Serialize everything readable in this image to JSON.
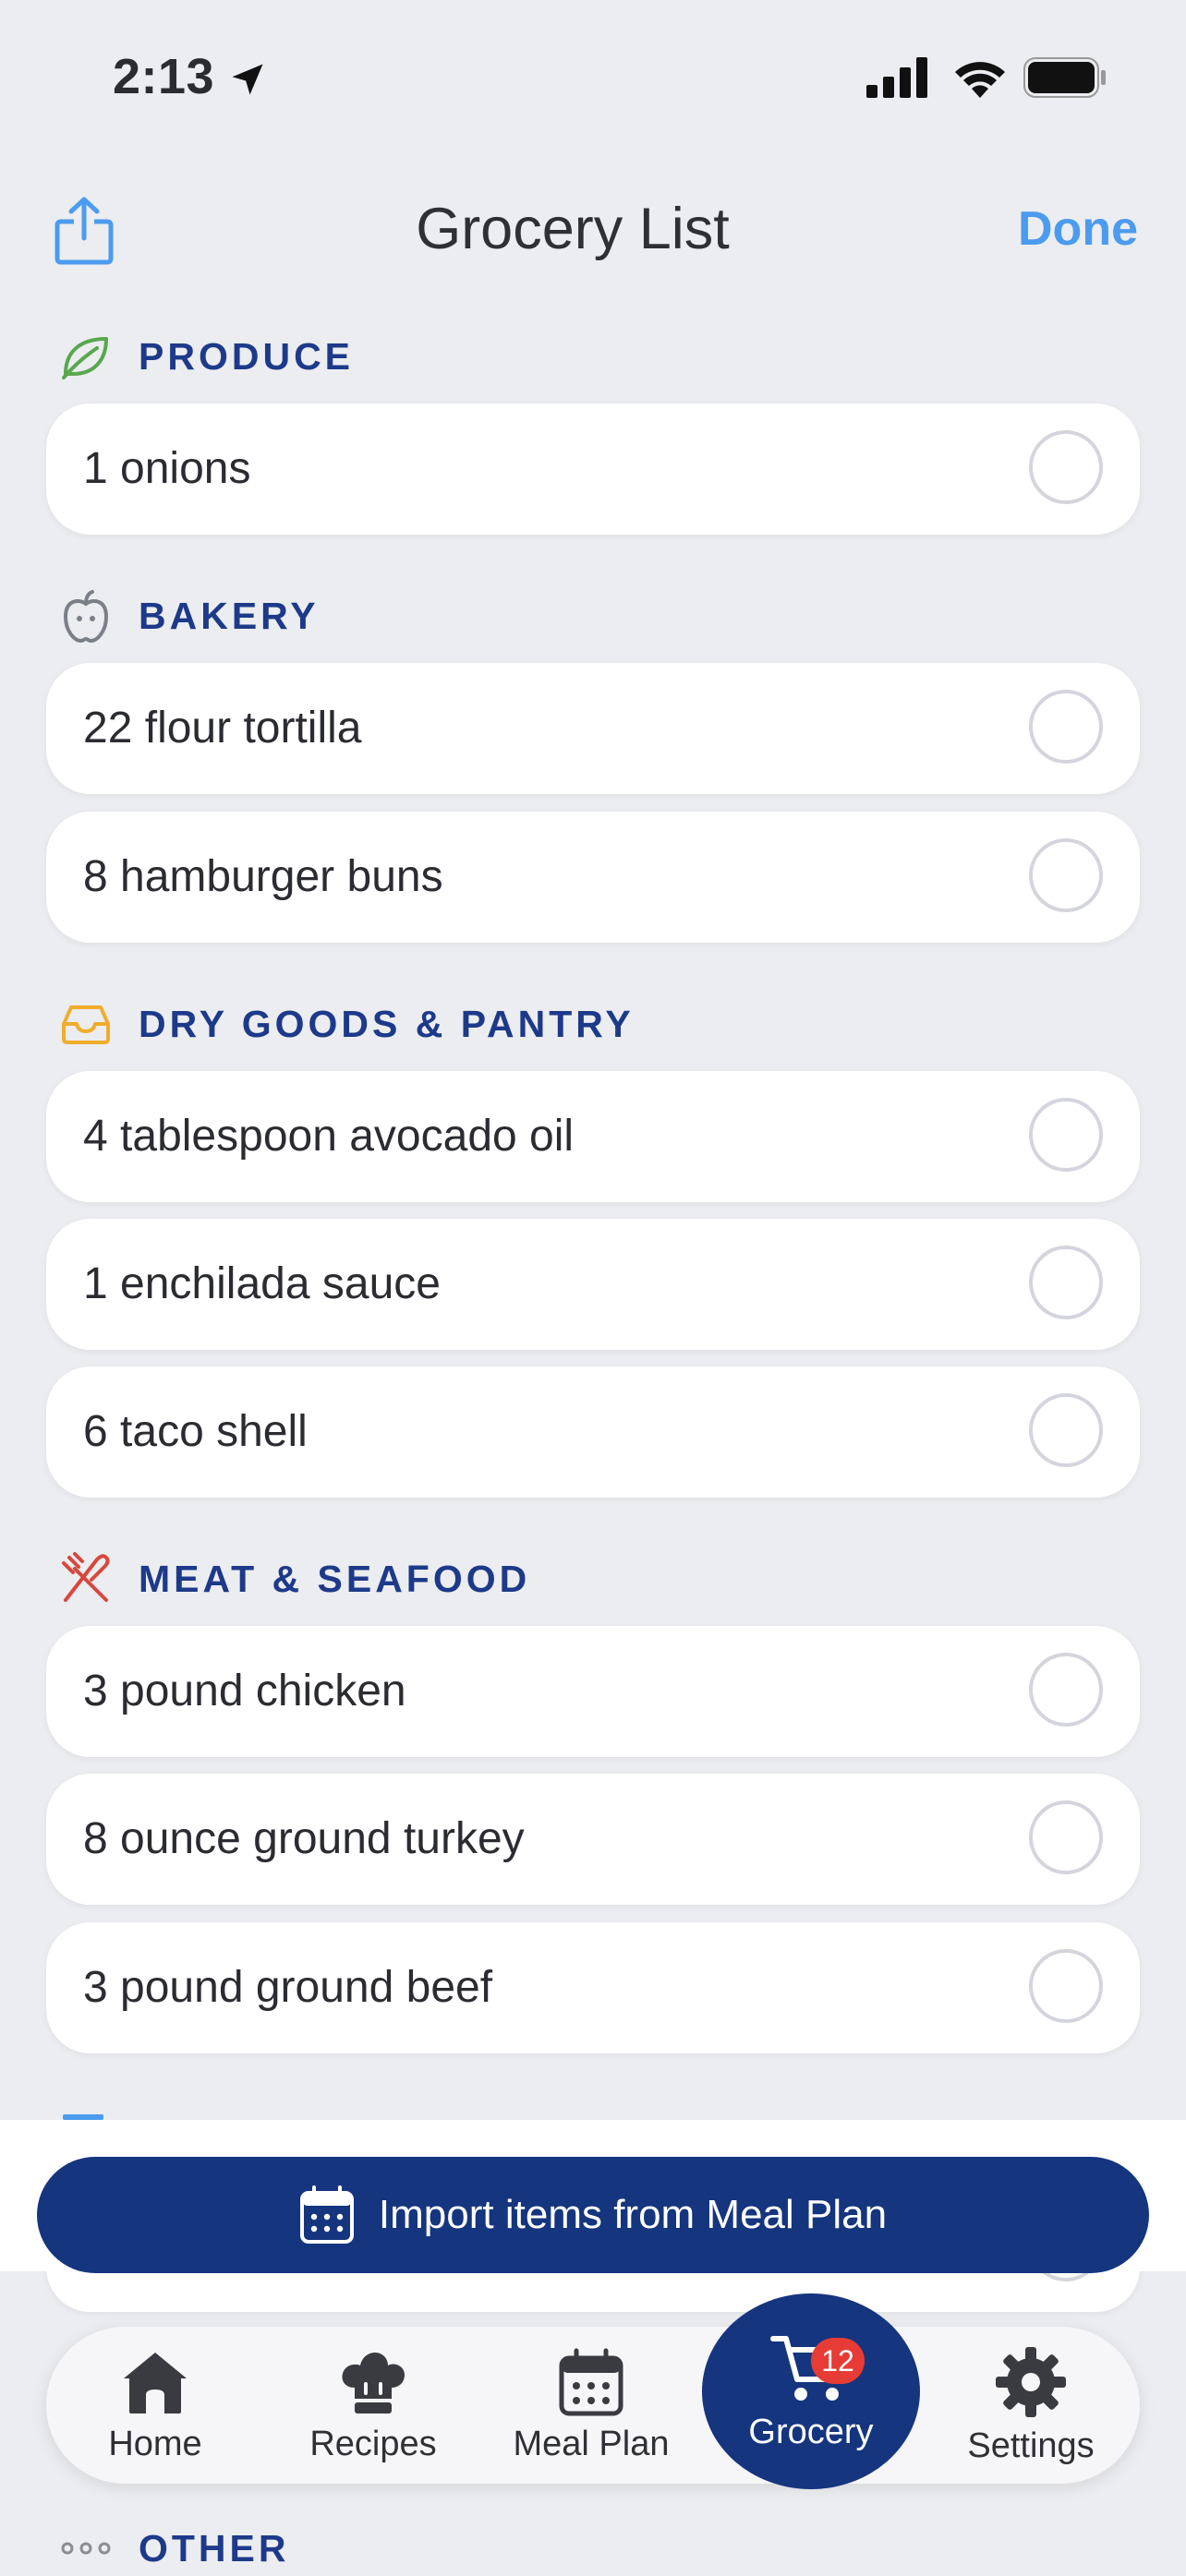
{
  "status_bar": {
    "time": "2:13"
  },
  "nav": {
    "title": "Grocery List",
    "done_label": "Done"
  },
  "sections": [
    {
      "label": "PRODUCE",
      "icon": "leaf-icon",
      "items": [
        "1 onions"
      ]
    },
    {
      "label": "BAKERY",
      "icon": "apple-icon",
      "items": [
        "22 flour tortilla",
        "8 hamburger buns"
      ]
    },
    {
      "label": "DRY GOODS & PANTRY",
      "icon": "tray-icon",
      "items": [
        "4 tablespoon avocado oil",
        "1 enchilada sauce",
        "6 taco shell"
      ]
    },
    {
      "label": "MEAT & SEAFOOD",
      "icon": "fork-knife-icon",
      "items": [
        "3 pound chicken",
        "8 ounce ground turkey",
        "3 pound ground beef"
      ]
    },
    {
      "label": "OTHER",
      "icon": "ellipsis-icon",
      "items": []
    }
  ],
  "import_button": {
    "label": "Import items from Meal Plan",
    "icon": "calendar-icon"
  },
  "tabs": [
    {
      "label": "Home",
      "icon": "house-icon"
    },
    {
      "label": "Recipes",
      "icon": "chef-hat-icon"
    },
    {
      "label": "Meal Plan",
      "icon": "calendar-icon"
    },
    {
      "label": "Grocery",
      "icon": "cart-icon",
      "badge": "12",
      "active": true
    },
    {
      "label": "Settings",
      "icon": "gear-icon"
    }
  ],
  "colors": {
    "accent": "#15357e",
    "link": "#4c9bef",
    "section_label": "#1d3a8a",
    "badge": "#e73b36",
    "background": "#ecedf0"
  }
}
